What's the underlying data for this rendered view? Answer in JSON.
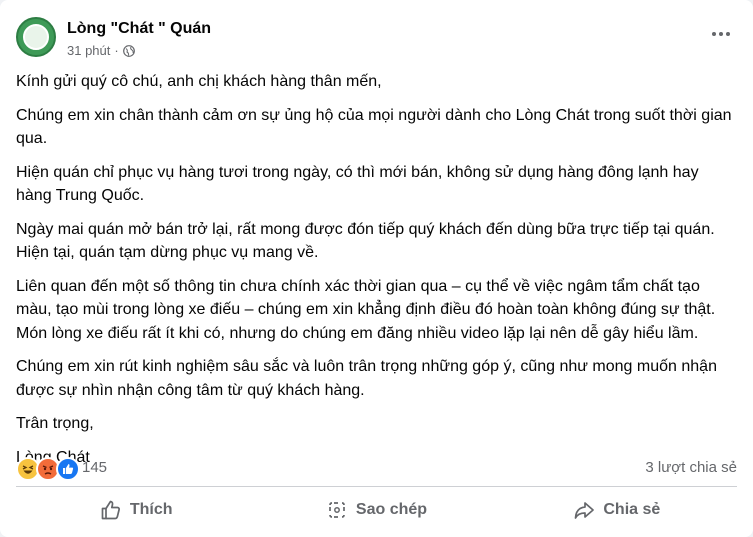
{
  "post": {
    "page_name": "Lòng \"Chát \" Quán",
    "time": "31 phút",
    "separator": "·",
    "paragraphs": [
      "Kính gửi quý cô chú, anh chị khách hàng thân mến,",
      "Chúng em xin chân thành cảm ơn sự ủng hộ của mọi người dành cho Lòng Chát trong suốt thời gian qua.",
      "Hiện quán chỉ phục vụ hàng tươi trong ngày, có thì mới bán, không sử dụng hàng đông lạnh hay hàng Trung Quốc.",
      "Ngày mai quán mở bán trở lại, rất mong được đón tiếp quý khách đến dùng bữa trực tiếp tại quán. Hiện tại, quán tạm dừng phục vụ mang về.",
      "Liên quan đến một số thông tin chưa chính xác thời gian qua – cụ thể về việc ngâm tẩm chất tạo màu, tạo mùi trong lòng xe điếu – chúng em xin khẳng định điều đó hoàn toàn không đúng sự thật. Món lòng xe điếu rất ít khi có, nhưng do chúng em đăng nhiều video lặp lại nên dễ gây hiểu lầm.",
      "Chúng em xin rút kinh nghiệm sâu sắc và luôn trân trọng những góp ý, cũng như mong muốn nhận được sự nhìn nhận công tâm từ quý khách hàng."
    ],
    "signoff": "Trân trọng,",
    "signature": "Lòng Chát"
  },
  "stats": {
    "reaction_count": "145",
    "share_count": "3 lượt chia sẻ",
    "reaction_icons": [
      "haha-icon",
      "angry-icon",
      "like-icon"
    ]
  },
  "actions": {
    "like": "Thích",
    "copy": "Sao chép",
    "share": "Chia sẻ"
  },
  "colors": {
    "secondary_text": "#65676b",
    "like_blue": "#1877f2",
    "avatar_green": "#3e9a57"
  }
}
